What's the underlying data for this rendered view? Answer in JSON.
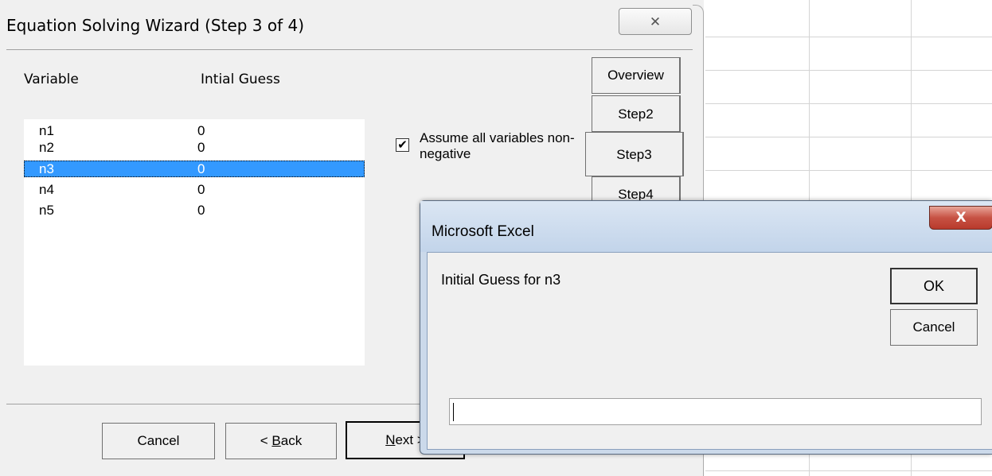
{
  "wizard": {
    "title": "Equation Solving Wizard (Step 3 of 4)",
    "close_icon": "close-icon",
    "close_glyph": "✕",
    "column_variable": "Variable",
    "column_initial_guess": "Intial Guess",
    "rows": [
      {
        "variable": "n1",
        "guess": "0",
        "selected": false
      },
      {
        "variable": "n2",
        "guess": "0",
        "selected": false
      },
      {
        "variable": "n3",
        "guess": "0",
        "selected": true
      },
      {
        "variable": "n4",
        "guess": "0",
        "selected": false
      },
      {
        "variable": "n5",
        "guess": "0",
        "selected": false
      }
    ],
    "checkbox": {
      "checked": true,
      "label": "Assume all variables non-negative"
    },
    "tabs": {
      "overview": "Overview",
      "step2": "Step2",
      "step3": "Step3",
      "step4": "Step4"
    },
    "buttons": {
      "cancel": "Cancel",
      "back_prefix": "< ",
      "back_hotkey": "B",
      "back_rest": "ack",
      "next_hotkey": "N",
      "next_rest": "ext >"
    }
  },
  "inputbox": {
    "title": "Microsoft Excel",
    "close_glyph": "X",
    "prompt": "Initial Guess for n3",
    "ok_label": "OK",
    "cancel_label": "Cancel",
    "value": ""
  }
}
